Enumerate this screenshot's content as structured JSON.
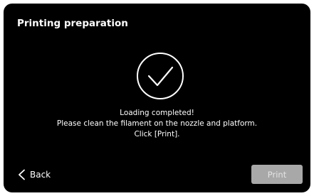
{
  "header": {
    "title": "Printing preparation"
  },
  "status": {
    "icon": "check-circle-icon",
    "lines": [
      "Loading completed!",
      "Please clean the filament on the nozzle and platform.",
      "Click [Print]."
    ]
  },
  "footer": {
    "back_icon": "chevron-left-icon",
    "back_label": "Back",
    "print_label": "Print",
    "print_state": "disabled"
  },
  "colors": {
    "background": "#000000",
    "text": "#ffffff",
    "button_disabled": "#a8a8a8"
  }
}
